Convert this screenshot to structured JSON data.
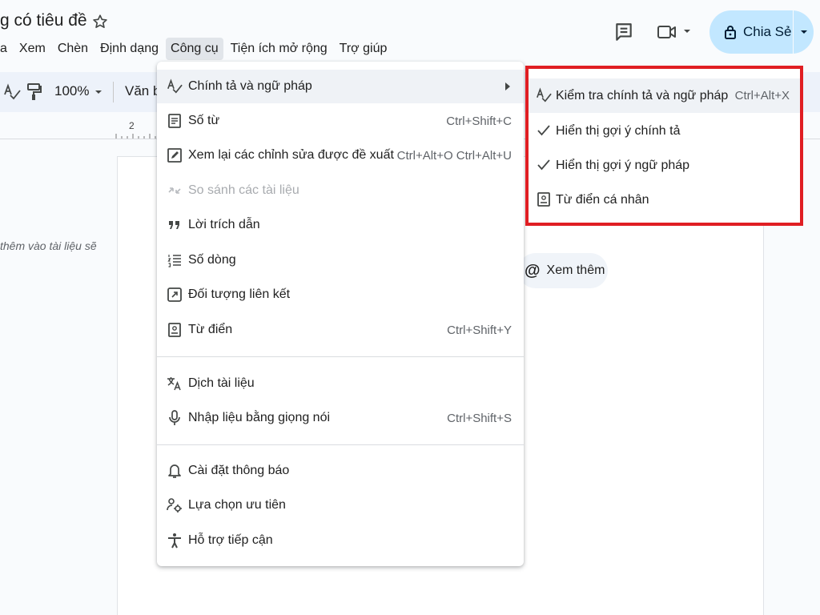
{
  "header": {
    "title": "g có tiêu đề",
    "menus": [
      "a",
      "Xem",
      "Chèn",
      "Định dạng",
      "Công cụ",
      "Tiện ích mở rộng",
      "Trợ giúp"
    ],
    "share_label": "Chia Sẻ"
  },
  "toolbar": {
    "zoom": "100%",
    "style": "Văn b"
  },
  "ruler": {
    "number": "2"
  },
  "document": {
    "side_hint": "thêm vào tài liệu sẽ",
    "chip_label": "Xem thêm"
  },
  "tools_menu": {
    "items": [
      {
        "label": "Chính tả và ngữ pháp",
        "shortcut": "",
        "icon": "spellcheck-icon"
      },
      {
        "label": "Số từ",
        "shortcut": "Ctrl+Shift+C",
        "icon": "word-count-icon"
      },
      {
        "label": "Xem lại các chỉnh sửa được đề xuất",
        "shortcut": "Ctrl+Alt+O Ctrl+Alt+U",
        "icon": "review-edits-icon"
      },
      {
        "label": "So sánh các tài liệu",
        "shortcut": "",
        "icon": "compare-icon"
      },
      {
        "label": "Lời trích dẫn",
        "shortcut": "",
        "icon": "quote-icon"
      },
      {
        "label": "Số dòng",
        "shortcut": "",
        "icon": "line-numbers-icon"
      },
      {
        "label": "Đối tượng liên kết",
        "shortcut": "",
        "icon": "linked-objects-icon"
      },
      {
        "label": "Từ điển",
        "shortcut": "Ctrl+Shift+Y",
        "icon": "dictionary-icon"
      },
      {
        "label": "Dịch tài liệu",
        "shortcut": "",
        "icon": "translate-icon"
      },
      {
        "label": "Nhập liệu bằng giọng nói",
        "shortcut": "Ctrl+Shift+S",
        "icon": "microphone-icon"
      },
      {
        "label": "Cài đặt thông báo",
        "shortcut": "",
        "icon": "bell-icon"
      },
      {
        "label": "Lựa chọn ưu tiên",
        "shortcut": "",
        "icon": "preferences-icon"
      },
      {
        "label": "Hỗ trợ tiếp cận",
        "shortcut": "",
        "icon": "accessibility-icon"
      }
    ]
  },
  "spelling_submenu": {
    "items": [
      {
        "label": "Kiểm tra chính tả và ngữ pháp",
        "shortcut": "Ctrl+Alt+X",
        "icon": "spellcheck-icon"
      },
      {
        "label": "Hiển thị gợi ý chính tả",
        "shortcut": "",
        "icon": "check-icon"
      },
      {
        "label": "Hiển thị gợi ý ngữ pháp",
        "shortcut": "",
        "icon": "check-icon"
      },
      {
        "label": "Từ điển cá nhân",
        "shortcut": "",
        "icon": "dictionary-icon"
      }
    ],
    "highlight_color": "#e01e23"
  },
  "colors": {
    "share_bg": "#c2e7ff",
    "toolbar_bg": "#edf2fa",
    "active_menu_bg": "#e1e5ea"
  }
}
